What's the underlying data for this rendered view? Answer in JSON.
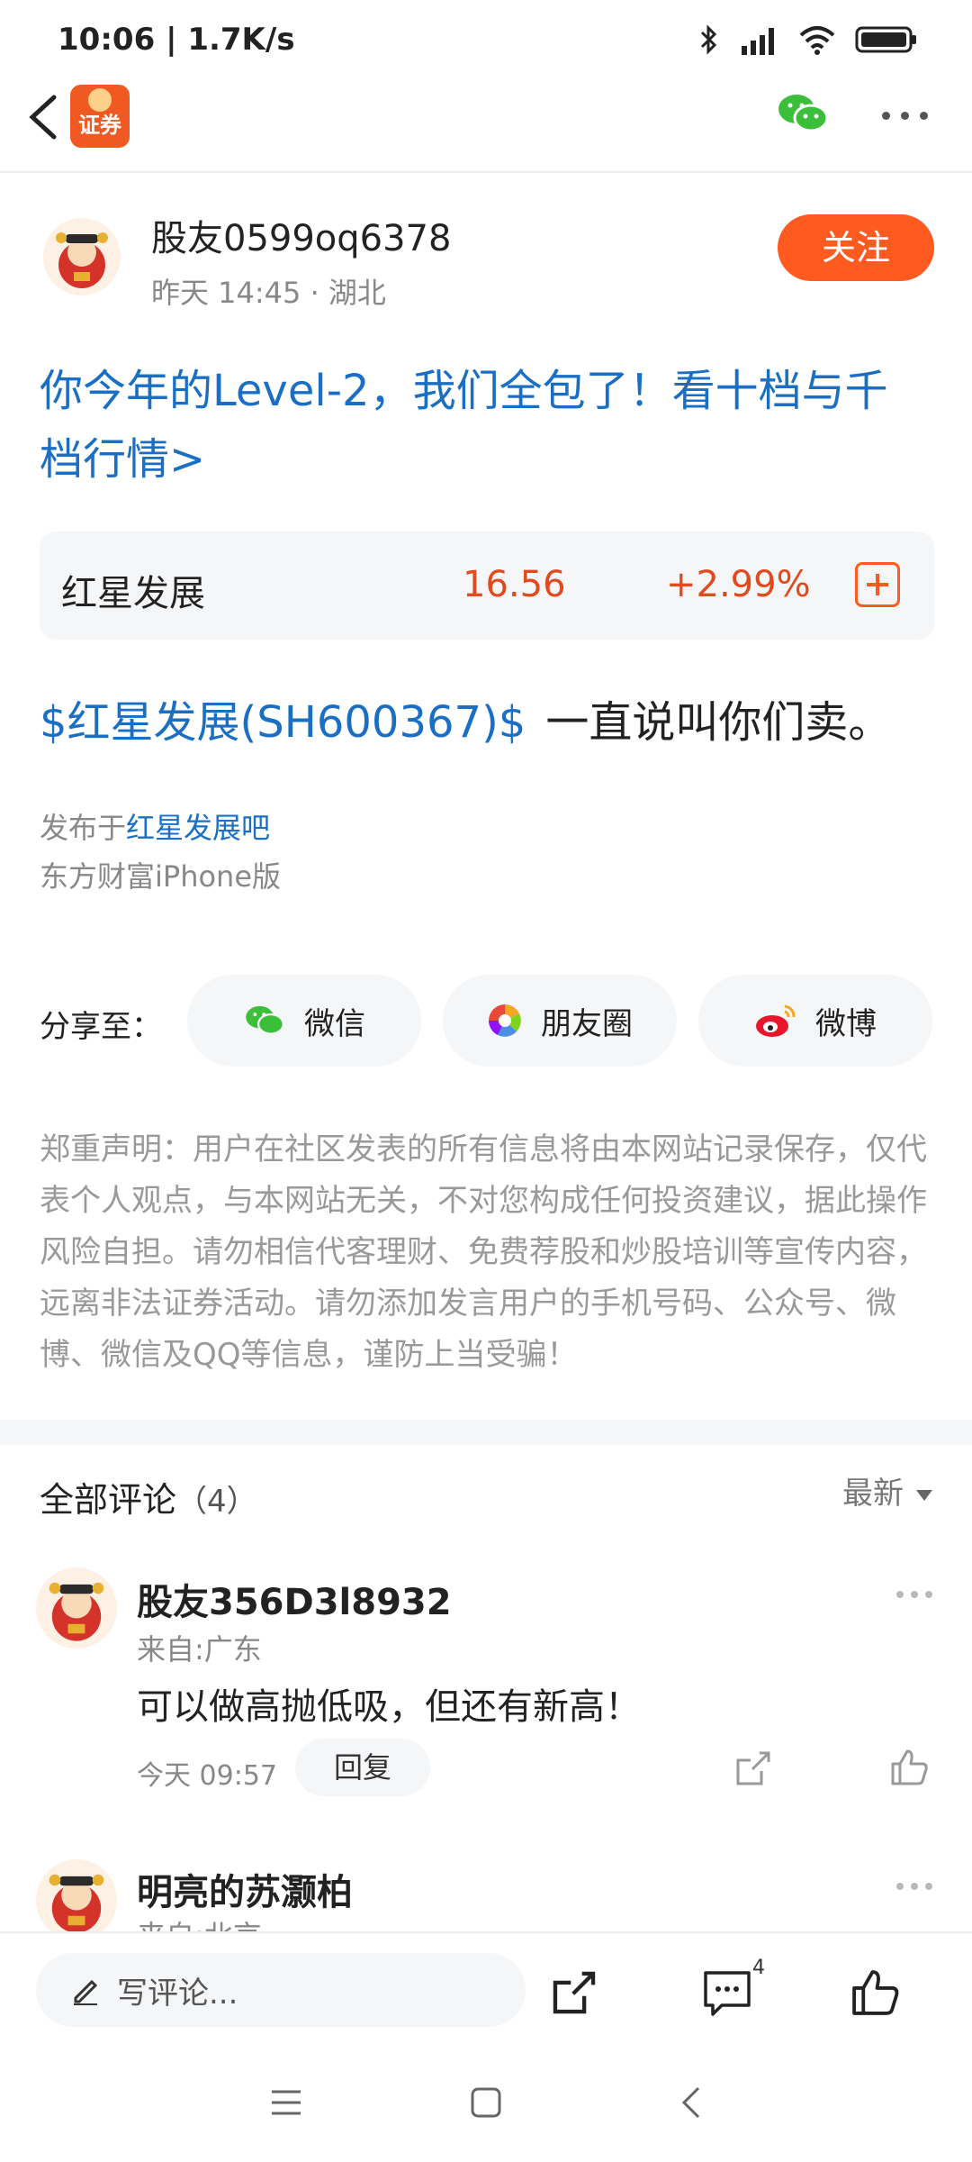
{
  "status_bar": {
    "time": "10:06 | 1.7K/s"
  },
  "header": {
    "app_logo_text": "证券"
  },
  "author": {
    "name": "股友0599oq6378",
    "meta": "昨天 14:45 · 湖北",
    "follow_label": "关注"
  },
  "promo_text": "你今年的Level-2，我们全包了！看十档与千档行情>",
  "stock": {
    "name": "红星发展",
    "price": "16.56",
    "change": "+2.99%"
  },
  "post": {
    "tag": "$红星发展(SH600367)$",
    "text": "一直说叫你们卖。"
  },
  "publish": {
    "prefix": "发布于",
    "forum": "红星发展吧",
    "client": "东方财富iPhone版"
  },
  "share": {
    "label": "分享至：",
    "wechat": "微信",
    "moments": "朋友圈",
    "weibo": "微博"
  },
  "disclaimer": "郑重声明：用户在社区发表的所有信息将由本网站记录保存，仅代表个人观点，与本网站无关，不对您构成任何投资建议，据此操作风险自担。请勿相信代客理财、免费荐股和炒股培训等宣传内容，远离非法证券活动。请勿添加发言用户的手机号码、公众号、微博、微信及QQ等信息，谨防上当受骗！",
  "comments": {
    "title": "全部评论",
    "count": "（4）",
    "sort": "最新",
    "items": [
      {
        "name": "股友356D3l8932",
        "location": "来自:广东",
        "text": "可以做高抛低吸，但还有新高！",
        "time": "今天 09:57",
        "reply": "回复"
      },
      {
        "name": "明亮的苏灏柏",
        "location": "来自:北京"
      }
    ]
  },
  "bottom_bar": {
    "input_placeholder": "写评论...",
    "comment_badge": "4"
  }
}
